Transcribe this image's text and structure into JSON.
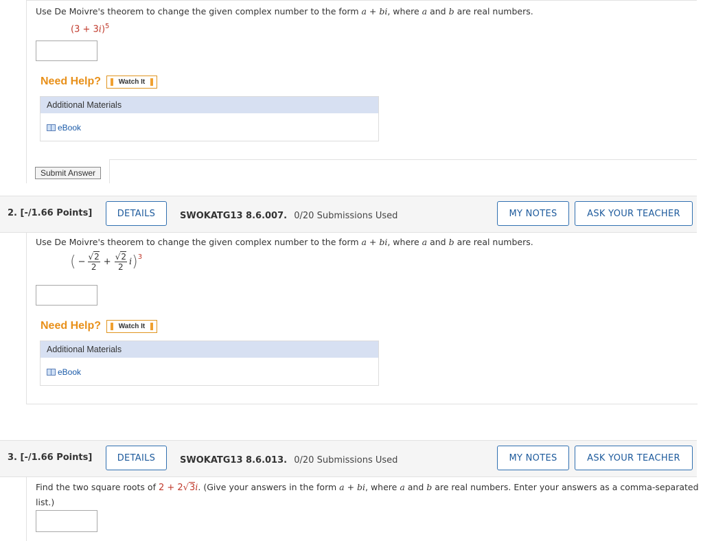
{
  "q1": {
    "instruction_pre": "Use De Moivre's theorem to change the given complex number to the form ",
    "form_a": "a",
    "form_plus": " + ",
    "form_bi": "bi",
    "instruction_mid": ", where ",
    "var_a": "a",
    "instruction_and": " and ",
    "var_b": "b",
    "instruction_post": " are real numbers.",
    "expression": "(3 + 3",
    "expression_i": "i",
    "expression_close": ")",
    "exponent": "5",
    "need_help": "Need Help?",
    "watch_it": "Watch It",
    "additional_materials": "Additional Materials",
    "ebook": "eBook",
    "submit": "Submit Answer"
  },
  "q2": {
    "number": "2.",
    "points": "[-/1.66 Points]",
    "details": "DETAILS",
    "code": "SWOKATG13 8.6.007.",
    "submissions": "0/20 Submissions Used",
    "my_notes": "MY NOTES",
    "ask_teacher": "ASK YOUR TEACHER",
    "instruction_pre": "Use De Moivre's theorem to change the given complex number to the form ",
    "instruction_post": " are real numbers.",
    "minus": "−",
    "plus": "+",
    "radicand": "2",
    "denominator": "2",
    "expression_i": "i",
    "exponent": "3",
    "need_help": "Need Help?",
    "watch_it": "Watch It",
    "additional_materials": "Additional Materials",
    "ebook": "eBook"
  },
  "q3": {
    "number": "3.",
    "points": "[-/1.66 Points]",
    "details": "DETAILS",
    "code": "SWOKATG13 8.6.013.",
    "submissions": "0/20 Submissions Used",
    "my_notes": "MY NOTES",
    "ask_teacher": "ASK YOUR TEACHER",
    "instruction_pre": "Find the two square roots of ",
    "expr_lead": "2 + 2",
    "expr_radicand": "3",
    "expr_i": "i",
    "instruction_mid": ". (Give your answers in the form ",
    "instruction_post": " are real numbers. Enter your answers as a comma-separated",
    "instruction_line2": "list.)"
  },
  "colors": {
    "accent_blue": "#1d5a9c",
    "help_orange": "#e8901a",
    "math_red": "#c0392b",
    "materials_header": "#d7e0f2"
  }
}
